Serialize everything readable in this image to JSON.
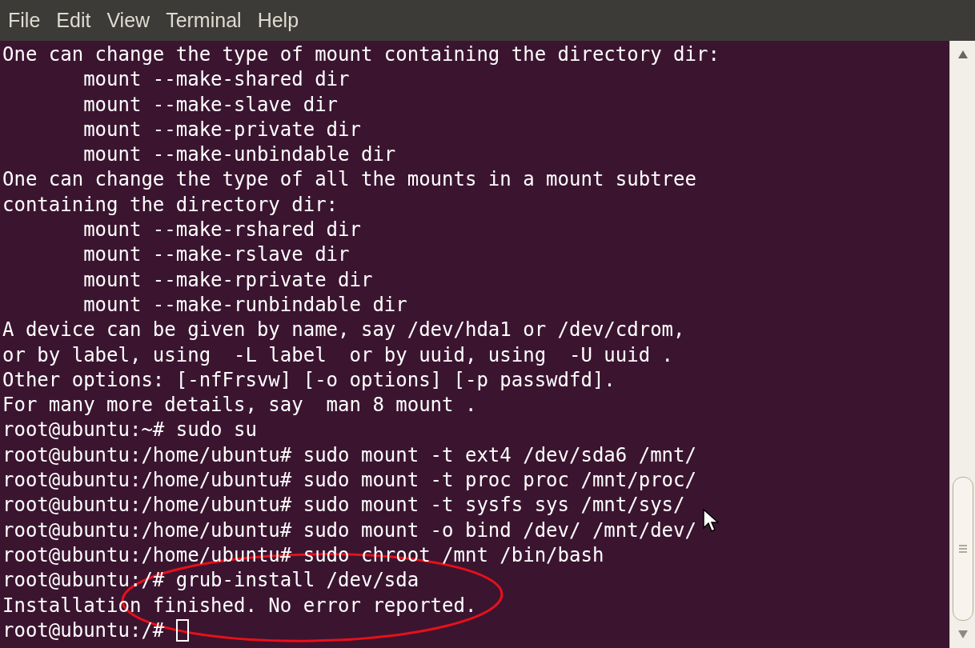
{
  "menu": [
    "File",
    "Edit",
    "View",
    "Terminal",
    "Help"
  ],
  "terminal": {
    "lines": [
      "One can change the type of mount containing the directory dir:",
      "       mount --make-shared dir",
      "       mount --make-slave dir",
      "       mount --make-private dir",
      "       mount --make-unbindable dir",
      "One can change the type of all the mounts in a mount subtree",
      "containing the directory dir:",
      "       mount --make-rshared dir",
      "       mount --make-rslave dir",
      "       mount --make-rprivate dir",
      "       mount --make-runbindable dir",
      "A device can be given by name, say /dev/hda1 or /dev/cdrom,",
      "or by label, using  -L label  or by uuid, using  -U uuid .",
      "Other options: [-nfFrsvw] [-o options] [-p passwdfd].",
      "For many more details, say  man 8 mount .",
      "root@ubuntu:~# sudo su",
      "root@ubuntu:/home/ubuntu# sudo mount -t ext4 /dev/sda6 /mnt/",
      "root@ubuntu:/home/ubuntu# sudo mount -t proc proc /mnt/proc/",
      "root@ubuntu:/home/ubuntu# sudo mount -t sysfs sys /mnt/sys/",
      "root@ubuntu:/home/ubuntu# sudo mount -o bind /dev/ /mnt/dev/",
      "root@ubuntu:/home/ubuntu# sudo chroot /mnt /bin/bash",
      "root@ubuntu:/# grub-install /dev/sda",
      "Installation finished. No error reported.",
      "root@ubuntu:/# "
    ],
    "cursor": true
  }
}
